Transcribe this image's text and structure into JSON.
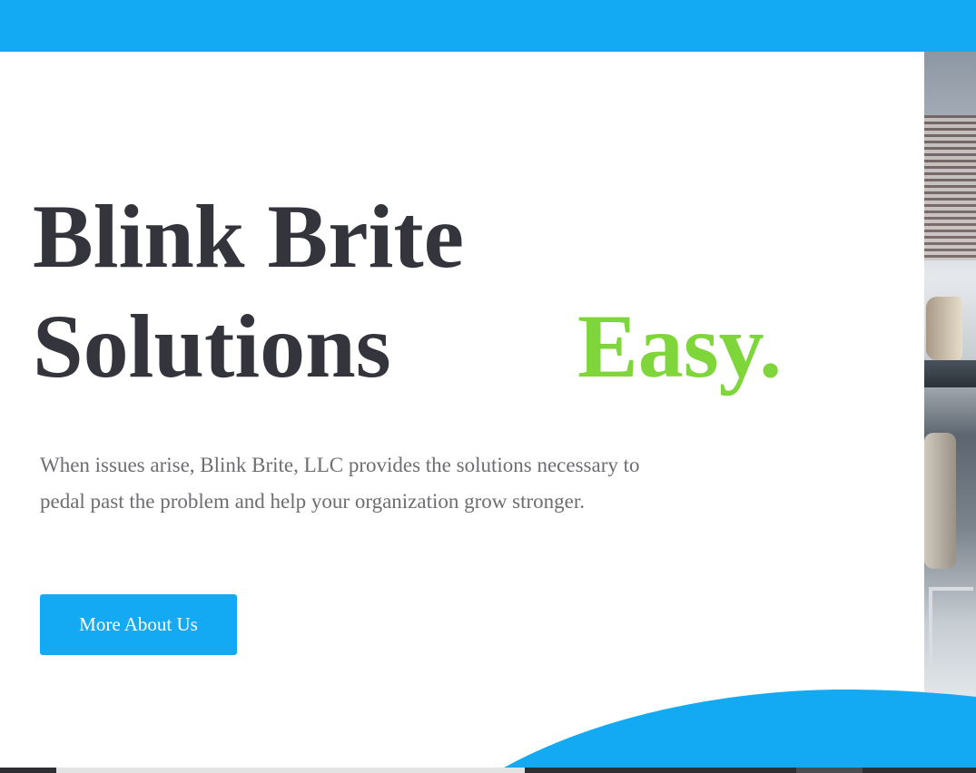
{
  "header": {
    "bar_color": "#14a9f3"
  },
  "hero": {
    "title_line1": "Blink Brite",
    "title_line2": "Solutions",
    "title_accent": "Easy.",
    "accent_color": "#7ed63a",
    "description": "When issues arise, Blink Brite, LLC provides the solutions necessary to pedal past the problem and help your organization grow stronger.",
    "cta_label": "More About Us",
    "cta_color": "#14a9f3",
    "image_subject": "office-interior-photo"
  }
}
